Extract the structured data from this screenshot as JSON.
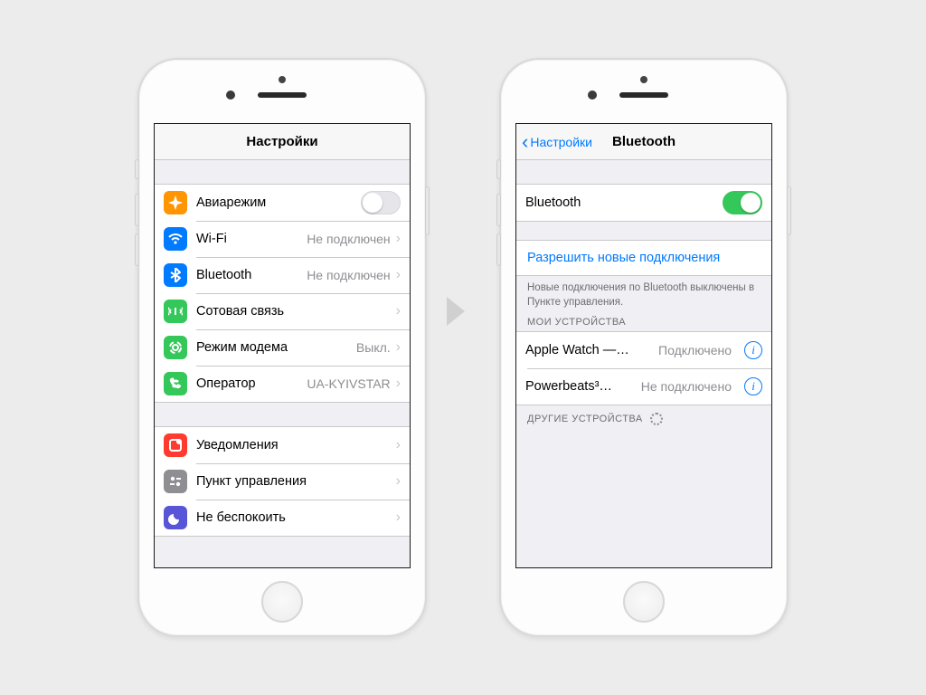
{
  "left": {
    "title": "Настройки",
    "group1": [
      {
        "icon": "airplane",
        "bg": "bg-orange",
        "label": "Авиарежим",
        "control": "switch",
        "on": false
      },
      {
        "icon": "wifi",
        "bg": "bg-blue",
        "label": "Wi-Fi",
        "value": "Не подключен",
        "chevron": true
      },
      {
        "icon": "bluetooth",
        "bg": "bg-blue",
        "label": "Bluetooth",
        "value": "Не подключен",
        "chevron": true
      },
      {
        "icon": "cellular",
        "bg": "bg-green",
        "label": "Сотовая связь",
        "chevron": true
      },
      {
        "icon": "hotspot",
        "bg": "bg-green",
        "label": "Режим модема",
        "value": "Выкл.",
        "chevron": true
      },
      {
        "icon": "carrier",
        "bg": "bg-green",
        "label": "Оператор",
        "value": "UA-KYIVSTAR",
        "chevron": true
      }
    ],
    "group2": [
      {
        "icon": "notify",
        "bg": "bg-red",
        "label": "Уведомления",
        "chevron": true
      },
      {
        "icon": "control",
        "bg": "bg-grey",
        "label": "Пункт управления",
        "chevron": true
      },
      {
        "icon": "dnd",
        "bg": "bg-purple",
        "label": "Не беспокоить",
        "chevron": true
      }
    ]
  },
  "right": {
    "back": "Настройки",
    "title": "Bluetooth",
    "toggle_label": "Bluetooth",
    "toggle_on": true,
    "allow_new": "Разрешить новые подключения",
    "footer_note": "Новые подключения по Bluetooth выключены в Пункте управления.",
    "my_devices_header": "МОИ УСТРОЙСТВА",
    "devices": [
      {
        "name": "Apple Watch —…",
        "status": "Подключено"
      },
      {
        "name": "Powerbeats³…",
        "status": "Не подключено"
      }
    ],
    "other_header": "ДРУГИЕ УСТРОЙСТВА"
  }
}
